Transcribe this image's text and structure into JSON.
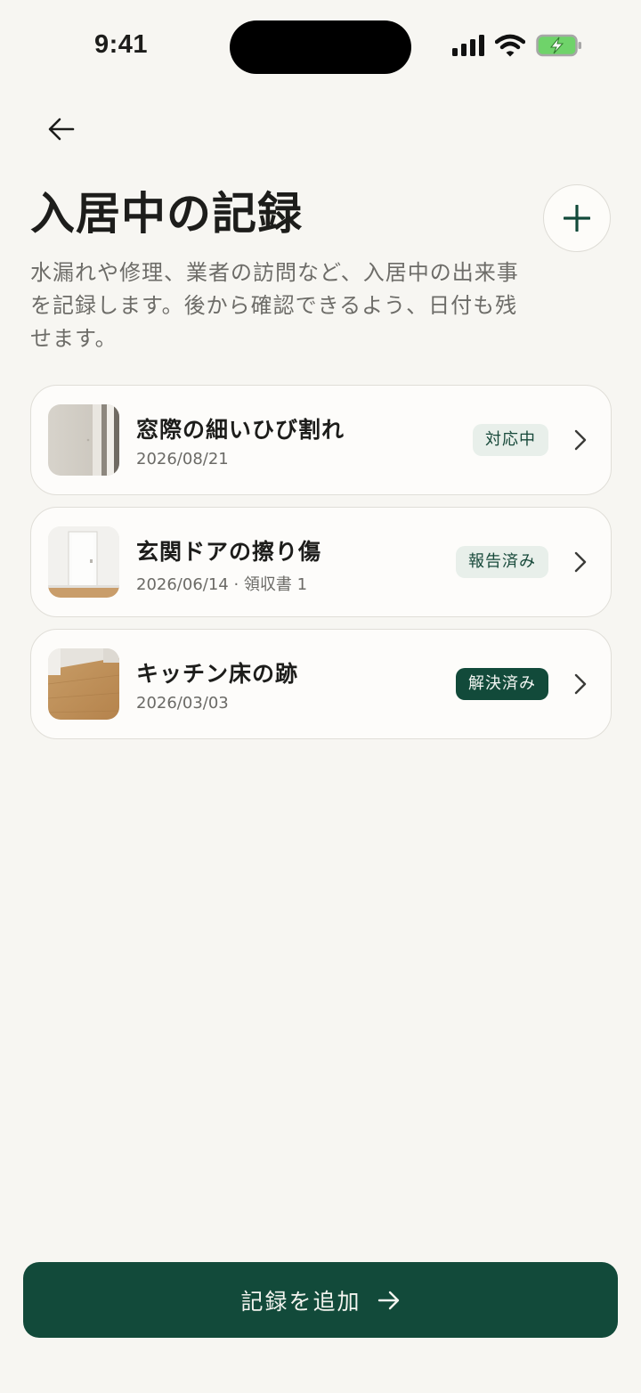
{
  "status_bar": {
    "time": "9:41"
  },
  "header": {
    "title": "入居中の記録",
    "description": "水漏れや修理、業者の訪問など、入居中の出来事を記録します。後から確認できるよう、日付も残せます。"
  },
  "records": [
    {
      "title": "窓際の細いひび割れ",
      "meta": "2026/08/21",
      "status": "対応中",
      "status_type": "in_progress"
    },
    {
      "title": "玄関ドアの擦り傷",
      "meta": "2026/06/14 · 領収書 1",
      "status": "報告済み",
      "status_type": "reported"
    },
    {
      "title": "キッチン床の跡",
      "meta": "2026/03/03",
      "status": "解決済み",
      "status_type": "resolved"
    }
  ],
  "cta": {
    "label": "記録を追加"
  },
  "colors": {
    "accent": "#124a3a",
    "background": "#f7f6f2",
    "badge_light": "#e8efea"
  }
}
